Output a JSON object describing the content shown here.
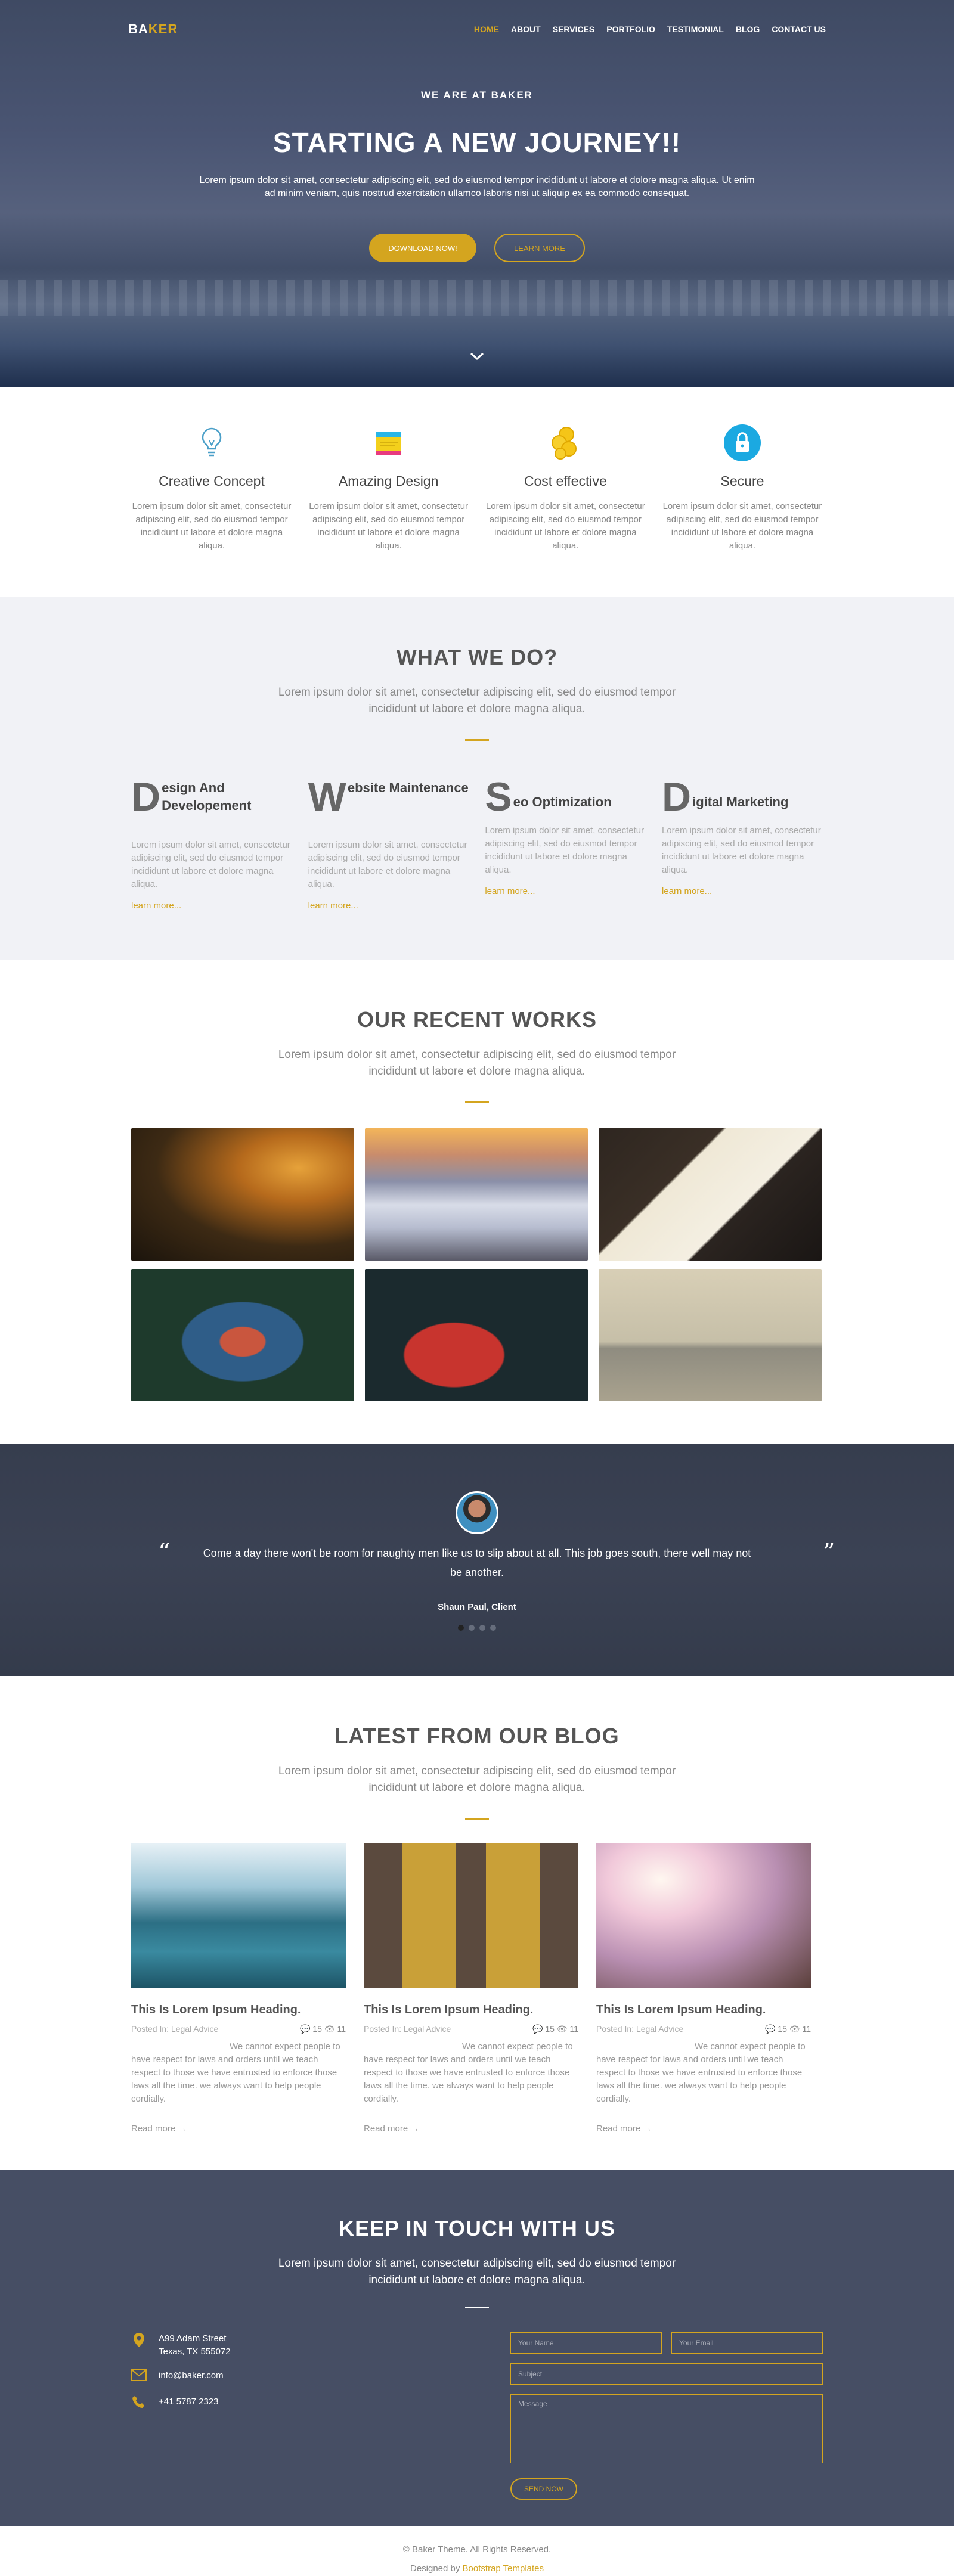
{
  "nav": {
    "logo_part1": "BA",
    "logo_part2": "KER",
    "items": [
      "HOME",
      "ABOUT",
      "SERVICES",
      "PORTFOLIO",
      "TESTIMONIAL",
      "BLOG",
      "CONTACT US"
    ]
  },
  "hero": {
    "eyebrow": "WE ARE AT BAKER",
    "title": "STARTING A NEW JOURNEY!!",
    "text": "Lorem ipsum dolor sit amet, consectetur adipiscing elit, sed do eiusmod tempor incididunt ut labore et dolore magna aliqua. Ut enim ad minim veniam, quis nostrud exercitation ullamco laboris nisi ut aliquip ex ea commodo consequat.",
    "download_label": "DOWNLOAD NOW!",
    "learn_label": "LEARN MORE"
  },
  "features": [
    {
      "title": "Creative Concept",
      "text": "Lorem ipsum dolor sit amet, consectetur adipiscing elit, sed do eiusmod tempor incididunt ut labore et dolore magna aliqua.",
      "icon": "lightbulb-icon"
    },
    {
      "title": "Amazing Design",
      "text": "Lorem ipsum dolor sit amet, consectetur adipiscing elit, sed do eiusmod tempor incididunt ut labore et dolore magna aliqua.",
      "icon": "note-icon"
    },
    {
      "title": "Cost effective",
      "text": "Lorem ipsum dolor sit amet, consectetur adipiscing elit, sed do eiusmod tempor incididunt ut labore et dolore magna aliqua.",
      "icon": "coins-icon"
    },
    {
      "title": "Secure",
      "text": "Lorem ipsum dolor sit amet, consectetur adipiscing elit, sed do eiusmod tempor incididunt ut labore et dolore magna aliqua.",
      "icon": "lock-icon"
    }
  ],
  "whatwedo": {
    "title": "WHAT WE DO?",
    "sub": "Lorem ipsum dolor sit amet, consectetur adipiscing elit, sed do eiusmod tempor incididunt ut labore et dolore magna aliqua.",
    "services": [
      {
        "initial": "D",
        "rest": "esign And Developement",
        "text": "Lorem ipsum dolor sit amet, consectetur adipiscing elit, sed do eiusmod tempor incididunt ut labore et dolore magna aliqua.",
        "link": "learn more..."
      },
      {
        "initial": "W",
        "rest": "ebsite Maintenance",
        "text": "Lorem ipsum dolor sit amet, consectetur adipiscing elit, sed do eiusmod tempor incididunt ut labore et dolore magna aliqua.",
        "link": "learn more..."
      },
      {
        "initial": "S",
        "rest": "eo Optimization",
        "text": "Lorem ipsum dolor sit amet, consectetur adipiscing elit, sed do eiusmod tempor incididunt ut labore et dolore magna aliqua.",
        "link": "learn more..."
      },
      {
        "initial": "D",
        "rest": "igital Marketing",
        "text": "Lorem ipsum dolor sit amet, consectetur adipiscing elit, sed do eiusmod tempor incididunt ut labore et dolore magna aliqua.",
        "link": "learn more..."
      }
    ]
  },
  "works": {
    "title": "OUR RECENT WORKS",
    "sub": "Lorem ipsum dolor sit amet, consectetur adipiscing elit, sed do eiusmod tempor incididunt ut labore et dolore magna aliqua."
  },
  "testimonial": {
    "quote": "Come a day there won't be room for naughty men like us to slip about at all. This job goes south, there well may not be another.",
    "author": "Shaun Paul, Client",
    "open_mark": "“",
    "close_mark": "”"
  },
  "blog": {
    "title": "LATEST FROM OUR BLOG",
    "sub": "Lorem ipsum dolor sit amet, consectetur adipiscing elit, sed do eiusmod tempor incididunt ut labore et dolore magna aliqua.",
    "posts": [
      {
        "title": "This Is Lorem Ipsum Heading.",
        "meta": "Posted In: Legal Advice",
        "comments": "15",
        "views": "11",
        "text": "We cannot expect people to have respect for laws and orders until we teach respect to those we have entrusted to enforce those laws all the time. we always want to help people cordially.",
        "more": "Read more →"
      },
      {
        "title": "This Is Lorem Ipsum Heading.",
        "meta": "Posted In: Legal Advice",
        "comments": "15",
        "views": "11",
        "text": "We cannot expect people to have respect for laws and orders until we teach respect to those we have entrusted to enforce those laws all the time. we always want to help people cordially.",
        "more": "Read more →"
      },
      {
        "title": "This Is Lorem Ipsum Heading.",
        "meta": "Posted In: Legal Advice",
        "comments": "15",
        "views": "11",
        "text": "We cannot expect people to have respect for laws and orders until we teach respect to those we have entrusted to enforce those laws all the time. we always want to help people cordially.",
        "more": "Read more →"
      }
    ]
  },
  "contact": {
    "title": "KEEP IN TOUCH WITH US",
    "sub": "Lorem ipsum dolor sit amet, consectetur adipiscing elit, sed do eiusmod tempor incididunt ut labore et dolore magna aliqua.",
    "address_line1": "A99 Adam Street",
    "address_line2": "Texas, TX 555072",
    "email": "info@baker.com",
    "phone": "+41 5787 2323",
    "name_placeholder": "Your Name",
    "email_placeholder": "Your Email",
    "subject_placeholder": "Subject",
    "message_placeholder": "Message",
    "send_label": "SEND NOW"
  },
  "footer": {
    "copyright": "© Baker Theme. All Rights Reserved.",
    "designed_by": "Designed by ",
    "designer": "Bootstrap Templates"
  },
  "colors": {
    "accent": "#d4a51f",
    "hero_bg": "#4a5573",
    "contact_bg": "#464e64",
    "testimonial_bg": "#3b4254"
  }
}
